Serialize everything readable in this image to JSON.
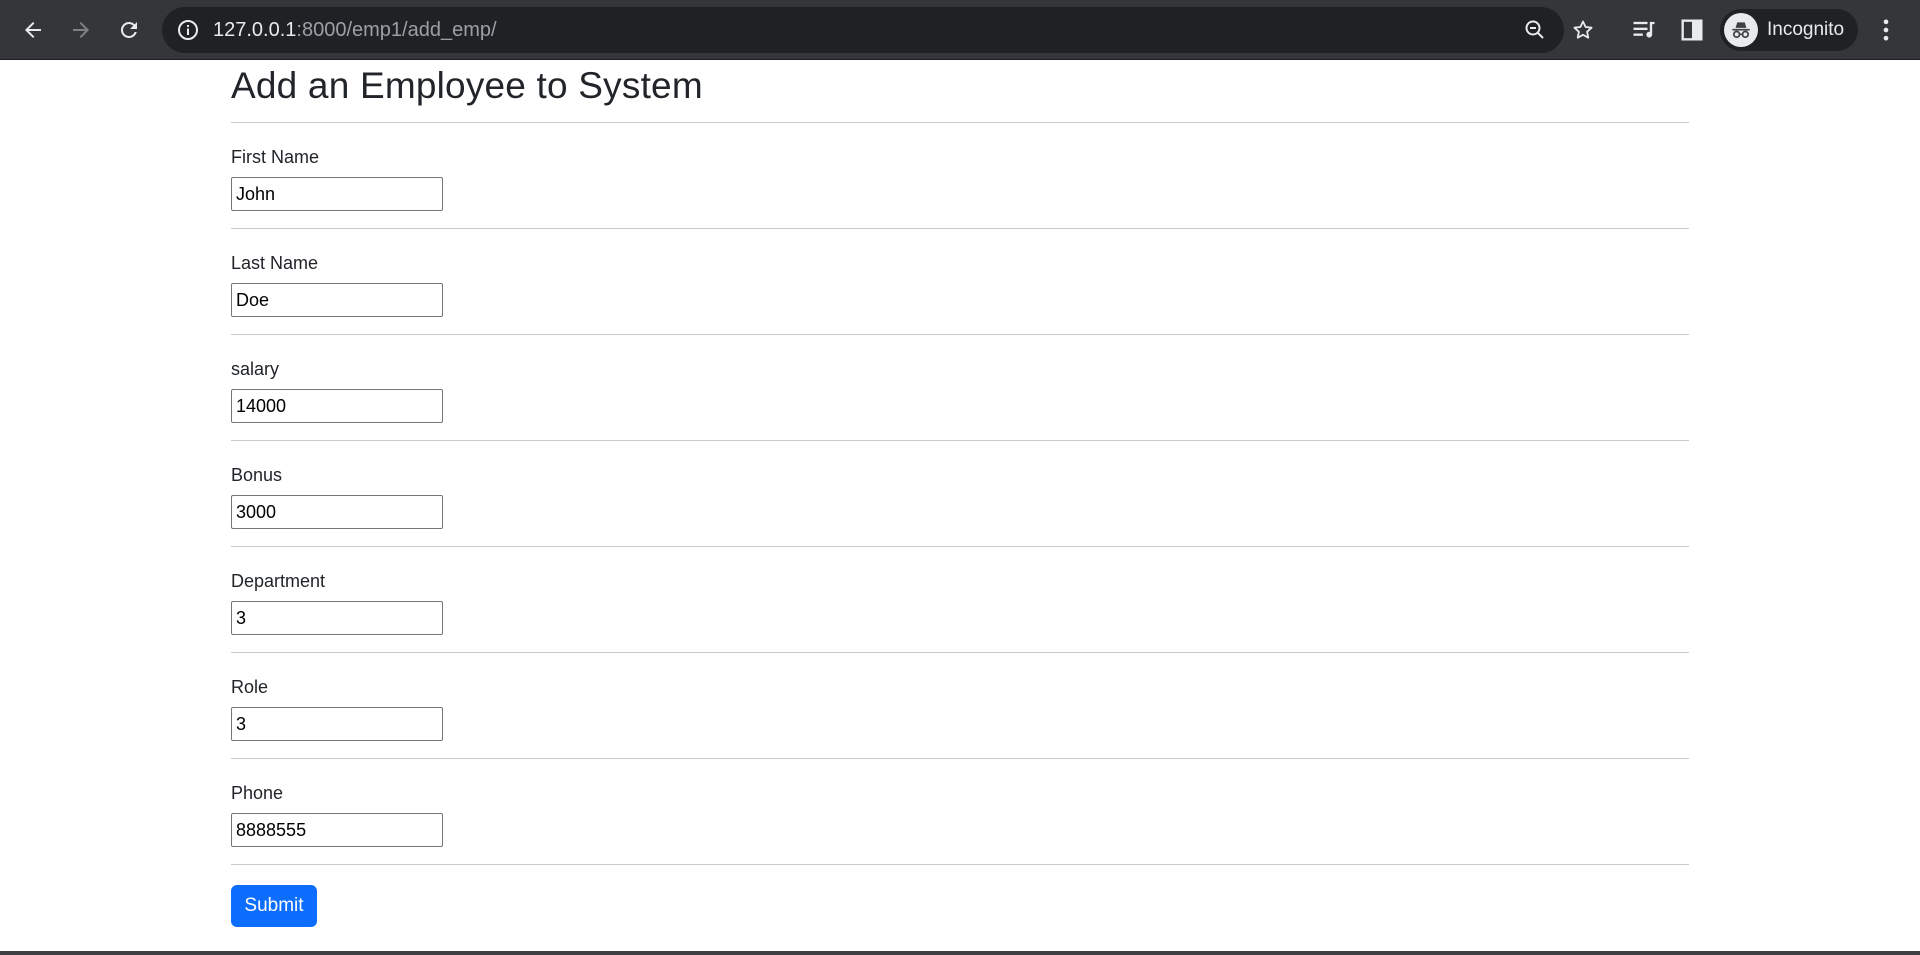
{
  "browser": {
    "url_host": "127.0.0.1",
    "url_path": ":8000/emp1/add_emp/",
    "profile_label": "Incognito",
    "icons": [
      "back-arrow-icon",
      "forward-arrow-icon",
      "reload-icon",
      "site-info-icon",
      "zoom-out-icon",
      "star-icon",
      "media-queue-icon",
      "side-panel-icon",
      "incognito-icon",
      "more-menu-icon"
    ]
  },
  "page": {
    "title": "Add an Employee to System",
    "fields": [
      {
        "label": "First Name",
        "value": "John"
      },
      {
        "label": "Last Name",
        "value": "Doe"
      },
      {
        "label": "salary",
        "value": "14000"
      },
      {
        "label": "Bonus",
        "value": "3000"
      },
      {
        "label": "Department",
        "value": "3"
      },
      {
        "label": "Role",
        "value": "3"
      },
      {
        "label": "Phone",
        "value": "8888555"
      }
    ],
    "submit_label": "Submit"
  },
  "colors": {
    "chrome_bg": "#35363a",
    "omnibox_bg": "#202124",
    "submit_bg": "#0d6efd",
    "text": "#212529"
  }
}
